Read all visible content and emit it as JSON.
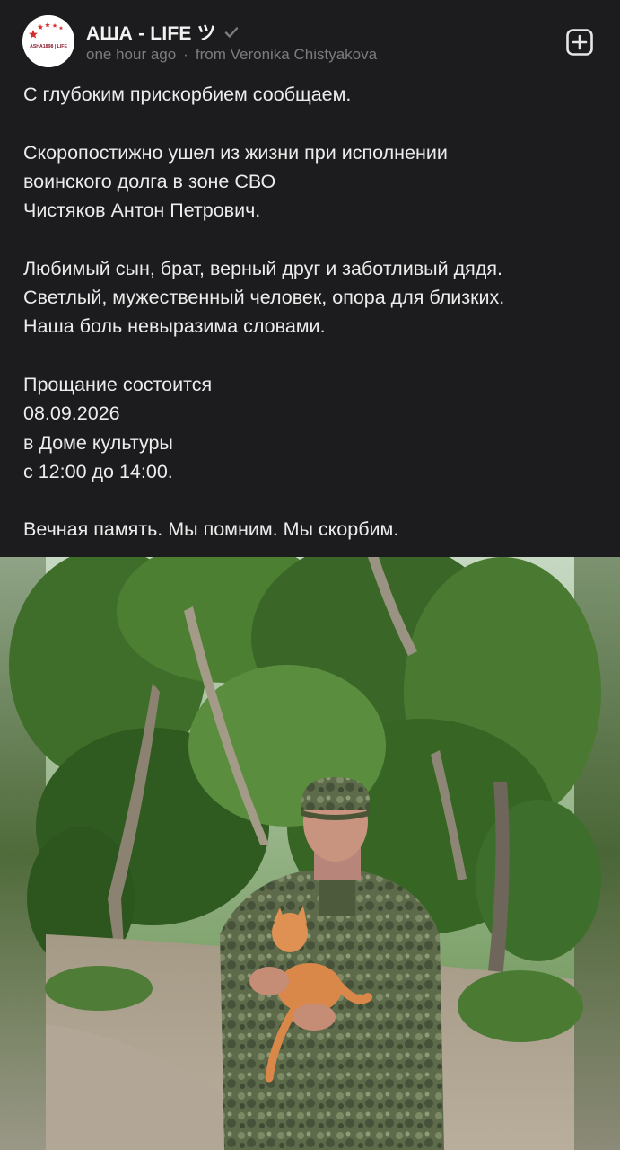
{
  "channel": {
    "name": "АША - LIFE ツ",
    "avatar_text": "ASHA1898 | LIFE",
    "time": "one hour ago",
    "separator": "·",
    "forwarded_from": "from Veronika Chistyakova"
  },
  "post": {
    "lines": [
      "С глубоким прискорбием сообщаем.",
      "",
      "Скоропостижно ушел из жизни при исполнении",
      "воинского долга в зоне СВО",
      "Чистяков Антон Петрович.",
      "",
      "Любимый сын, брат, верный друг и заботливый дядя.",
      "Светлый, мужественный человек, опора для близких.",
      "Наша боль невыразима словами.",
      "",
      "Прощание состоится",
      "08.09.2026",
      "в Доме культуры",
      "с 12:00 до 14:00.",
      "",
      "Вечная память. Мы помним. Мы скорбим."
    ]
  },
  "icons": {
    "verified": "check-icon",
    "add": "plus-square-icon"
  },
  "colors": {
    "background": "#1c1c1e",
    "text": "#ececec",
    "meta": "#7c7c80",
    "avatar_star": "#d62b2b"
  }
}
